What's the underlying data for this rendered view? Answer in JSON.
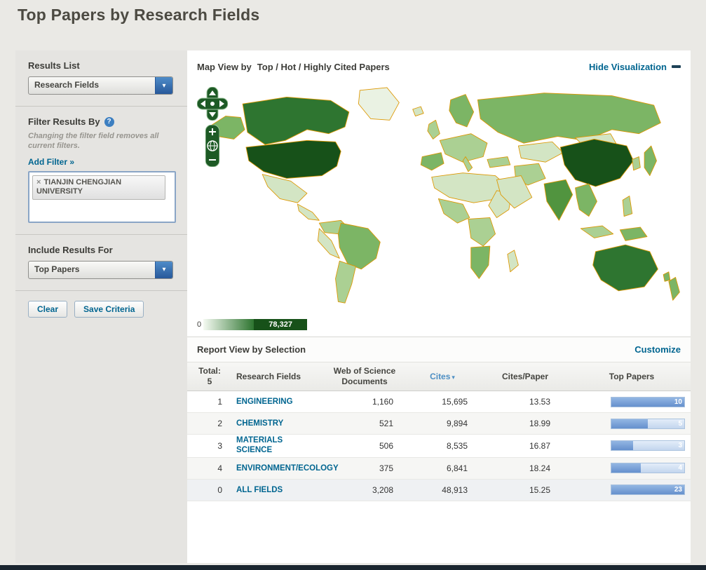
{
  "page": {
    "title": "Top Papers by Research Fields"
  },
  "icons": {
    "dropdown_chevron": "▾",
    "sort_desc": "▾",
    "help": "?",
    "remove_tag": "×"
  },
  "colors": {
    "link_teal": "#006590",
    "map_border_orange": "#dd9700",
    "legend_low": "#f5faf2",
    "legend_high": "#175119",
    "bar_blue": "#6590cd",
    "bottom_bar": "#1a252f"
  },
  "sidebar": {
    "results_list": {
      "label": "Results List",
      "selected": "Research Fields"
    },
    "filter": {
      "label": "Filter Results By",
      "note": "Changing the filter field removes all current filters.",
      "add_filter": "Add Filter »",
      "tags": [
        {
          "label": "TIANJIN CHENGJIAN UNIVERSITY"
        }
      ]
    },
    "include": {
      "label": "Include Results For",
      "selected": "Top Papers"
    },
    "buttons": {
      "clear": "Clear",
      "save": "Save Criteria"
    }
  },
  "map_view": {
    "title_prefix": "Map View by",
    "title": "Top / Hot / Highly Cited Papers",
    "hide_link": "Hide Visualization",
    "legend": {
      "min": "0",
      "max": "78,327"
    }
  },
  "report": {
    "title": "Report View by Selection",
    "customize_link": "Customize",
    "header": {
      "total_label": "Total:",
      "total_value": "5",
      "research_fields": "Research Fields",
      "documents": "Web of Science Documents",
      "cites": "Cites",
      "cites_per_paper": "Cites/Paper",
      "top_papers": "Top Papers"
    },
    "rows": [
      {
        "rank": "1",
        "field": "ENGINEERING",
        "documents": "1,160",
        "cites": "15,695",
        "cites_per_paper": "13.53",
        "top_papers": "10",
        "bar_pct": 100
      },
      {
        "rank": "2",
        "field": "CHEMISTRY",
        "documents": "521",
        "cites": "9,894",
        "cites_per_paper": "18.99",
        "top_papers": "5",
        "bar_pct": 50
      },
      {
        "rank": "3",
        "field": "MATERIALS SCIENCE",
        "documents": "506",
        "cites": "8,535",
        "cites_per_paper": "16.87",
        "top_papers": "3",
        "bar_pct": 30
      },
      {
        "rank": "4",
        "field": "ENVIRONMENT/ECOLOGY",
        "documents": "375",
        "cites": "6,841",
        "cites_per_paper": "18.24",
        "top_papers": "4",
        "bar_pct": 40
      },
      {
        "rank": "0",
        "field": "ALL FIELDS",
        "documents": "3,208",
        "cites": "48,913",
        "cites_per_paper": "15.25",
        "top_papers": "23",
        "bar_pct": 100
      }
    ]
  }
}
